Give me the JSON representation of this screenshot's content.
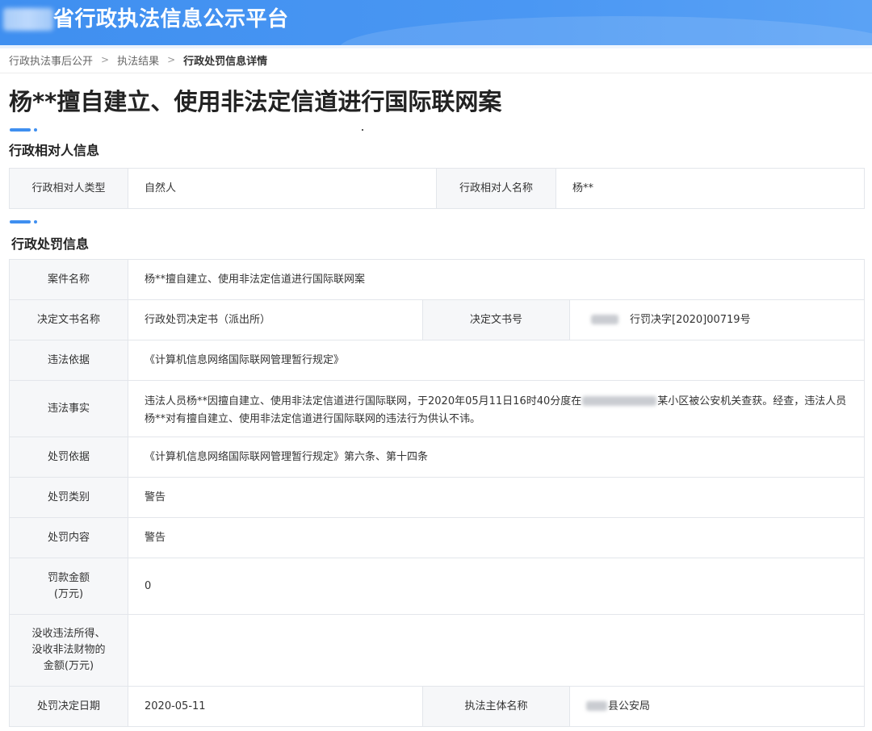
{
  "header": {
    "title": "省行政执法信息公示平台"
  },
  "breadcrumb": {
    "items": [
      "行政执法事后公开",
      "执法结果"
    ],
    "current": "行政处罚信息详情"
  },
  "page": {
    "title": "杨**擅自建立、使用非法定信道进行国际联网案"
  },
  "party_section": {
    "title": "行政相对人信息",
    "type_label": "行政相对人类型",
    "type_value": "自然人",
    "name_label": "行政相对人名称",
    "name_value": "杨**"
  },
  "penalty_section": {
    "title": "行政处罚信息",
    "case_name": {
      "label": "案件名称",
      "value": "杨**擅自建立、使用非法定信道进行国际联网案"
    },
    "doc_name": {
      "label": "决定文书名称",
      "value": "行政处罚决定书（派出所）"
    },
    "doc_no": {
      "label": "决定文书号",
      "value": "行罚决字[2020]00719号"
    },
    "basis": {
      "label": "违法依据",
      "value": "《计算机信息网络国际联网管理暂行规定》"
    },
    "facts": {
      "label": "违法事实",
      "value_part1": "违法人员杨**因擅自建立、使用非法定信道进行国际联网，于2020年05月11日16时40分度在",
      "value_part2": "某小区被公安机关查获。经查，违法人员杨**对有擅自建立、使用非法定信道进行国际联网的违法行为供认不讳。"
    },
    "penalty_basis": {
      "label": "处罚依据",
      "value": "《计算机信息网络国际联网管理暂行规定》第六条、第十四条"
    },
    "penalty_type": {
      "label": "处罚类别",
      "value": "警告"
    },
    "penalty_content": {
      "label": "处罚内容",
      "value": "警告"
    },
    "fine": {
      "label_line1": "罚款金额",
      "label_line2": "(万元)",
      "value": "0"
    },
    "confiscation": {
      "label_line1": "没收违法所得、",
      "label_line2": "没收非法财物的",
      "label_line3": "金额(万元)",
      "value": ""
    },
    "decision_date": {
      "label": "处罚决定日期",
      "value": "2020-05-11"
    },
    "authority": {
      "label": "执法主体名称",
      "value": "县公安局"
    }
  },
  "colors": {
    "header_blue": "#3f8ff0",
    "label_bg": "#f6f7f9",
    "border": "#e3e6eb"
  }
}
